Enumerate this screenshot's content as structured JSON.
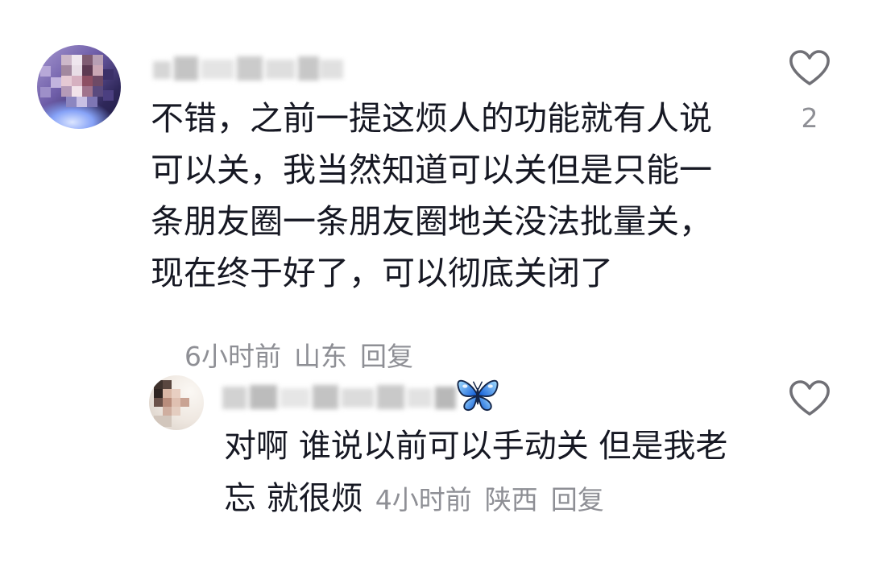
{
  "colors": {
    "background": "#ffffff",
    "text": "#161823",
    "meta": "#8e8f95",
    "icon": "#707076"
  },
  "comment": {
    "text_lines": [
      "不错，之前一提这烦人的功能就有人说",
      "可以关，我当然知道可以关但是只能一",
      "条朋友圈一条朋友圈地关没法批量关，",
      "现在终于好了，可以彻底关闭了"
    ],
    "time": "6小时前",
    "location": "山东",
    "reply_label": "回复",
    "like_icon": "heart-outline-icon",
    "like_count": "2"
  },
  "reply": {
    "name_emoji_icon": "butterfly-emoji-icon",
    "text_lines": [
      "对啊 谁说以前可以手动关 但是我老",
      "忘 就很烦"
    ],
    "time": "4小时前",
    "location": "陕西",
    "reply_label": "回复",
    "like_icon": "heart-outline-icon"
  }
}
